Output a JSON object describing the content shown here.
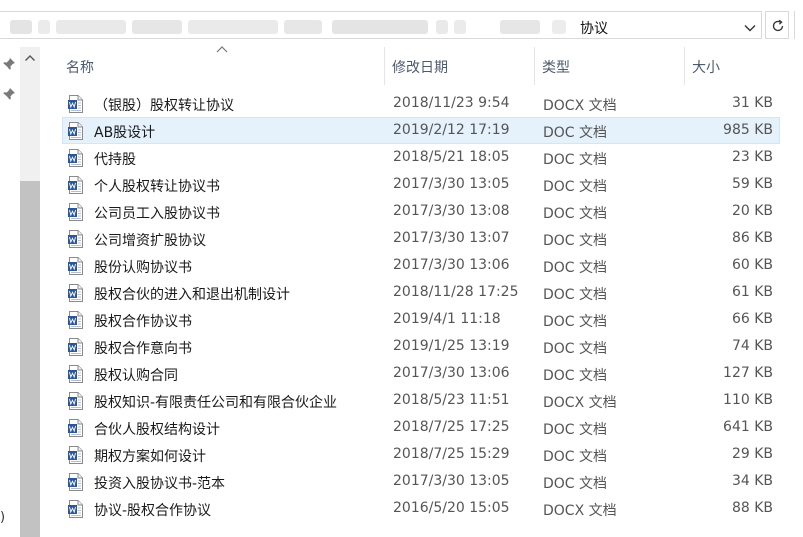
{
  "address": {
    "crumb": "协议",
    "blur_color": "#e4e4e4"
  },
  "columns": {
    "name": "名称",
    "date": "修改日期",
    "type": "类型",
    "size": "大小"
  },
  "nav": {
    "fragment": ")"
  },
  "files": [
    {
      "name": "（银股）股权转让协议",
      "date": "2018/11/23 9:54",
      "type": "DOCX 文档",
      "size": "31 KB",
      "icon": "word-docx-icon",
      "selected": false
    },
    {
      "name": "AB股设计",
      "date": "2019/2/12 17:19",
      "type": "DOC 文档",
      "size": "985 KB",
      "icon": "word-doc-icon",
      "selected": true
    },
    {
      "name": "代持股",
      "date": "2018/5/21 18:05",
      "type": "DOC 文档",
      "size": "23 KB",
      "icon": "word-doc-icon",
      "selected": false
    },
    {
      "name": "个人股权转让协议书",
      "date": "2017/3/30 13:05",
      "type": "DOC 文档",
      "size": "59 KB",
      "icon": "word-doc-icon",
      "selected": false
    },
    {
      "name": "公司员工入股协议书",
      "date": "2017/3/30 13:08",
      "type": "DOC 文档",
      "size": "20 KB",
      "icon": "word-doc-icon",
      "selected": false
    },
    {
      "name": "公司增资扩股协议",
      "date": "2017/3/30 13:07",
      "type": "DOC 文档",
      "size": "86 KB",
      "icon": "word-doc-icon",
      "selected": false
    },
    {
      "name": "股份认购协议书",
      "date": "2017/3/30 13:06",
      "type": "DOC 文档",
      "size": "60 KB",
      "icon": "word-doc-icon",
      "selected": false
    },
    {
      "name": "股权合伙的进入和退出机制设计",
      "date": "2018/11/28 17:25",
      "type": "DOC 文档",
      "size": "61 KB",
      "icon": "word-doc-icon",
      "selected": false
    },
    {
      "name": "股权合作协议书",
      "date": "2019/4/1 11:18",
      "type": "DOC 文档",
      "size": "66 KB",
      "icon": "word-doc-icon",
      "selected": false
    },
    {
      "name": "股权合作意向书",
      "date": "2019/1/25 13:19",
      "type": "DOC 文档",
      "size": "74 KB",
      "icon": "word-doc-icon",
      "selected": false
    },
    {
      "name": "股权认购合同",
      "date": "2017/3/30 13:06",
      "type": "DOC 文档",
      "size": "127 KB",
      "icon": "word-doc-icon",
      "selected": false
    },
    {
      "name": "股权知识-有限责任公司和有限合伙企业",
      "date": "2018/5/23 11:51",
      "type": "DOCX 文档",
      "size": "110 KB",
      "icon": "word-docx-icon",
      "selected": false
    },
    {
      "name": "合伙人股权结构设计",
      "date": "2018/7/25 17:25",
      "type": "DOC 文档",
      "size": "641 KB",
      "icon": "word-doc-icon",
      "selected": false
    },
    {
      "name": "期权方案如何设计",
      "date": "2018/7/25 15:29",
      "type": "DOC 文档",
      "size": "29 KB",
      "icon": "word-doc-icon",
      "selected": false
    },
    {
      "name": "投资入股协议书-范本",
      "date": "2017/3/30 13:05",
      "type": "DOC 文档",
      "size": "34 KB",
      "icon": "word-doc-icon",
      "selected": false
    },
    {
      "name": "协议-股权合作协议",
      "date": "2016/5/20 15:05",
      "type": "DOCX 文档",
      "size": "88 KB",
      "icon": "word-docx-icon",
      "selected": false
    }
  ],
  "colors": {
    "selection_bg": "#e5f1fb",
    "selection_border": "#cce8ff",
    "word_blue": "#2b579a",
    "header_text": "#4d5a6e"
  }
}
